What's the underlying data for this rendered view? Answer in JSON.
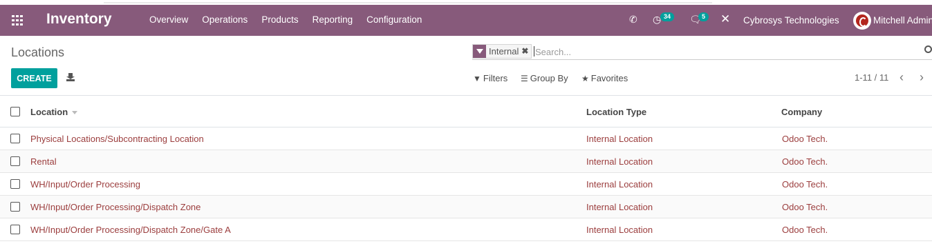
{
  "navbar": {
    "app_name": "Inventory",
    "menu": [
      "Overview",
      "Operations",
      "Products",
      "Reporting",
      "Configuration"
    ],
    "activities_count": "34",
    "messages_count": "5",
    "company": "Cybrosys Technologies",
    "user": "Mitchell Admin",
    "bg_color": "#875a7b"
  },
  "control_panel": {
    "title": "Locations",
    "create_label": "CREATE",
    "facet": "Internal",
    "search_placeholder": "Search...",
    "filters_label": "Filters",
    "groupby_label": "Group By",
    "favorites_label": "Favorites",
    "pager": "1-11 / 11",
    "accent_color": "#00a09d"
  },
  "table": {
    "columns": [
      "Location",
      "Location Type",
      "Company"
    ],
    "rows": [
      {
        "location": "Physical Locations/Subcontracting Location",
        "type": "Internal Location",
        "company": "Odoo Tech."
      },
      {
        "location": "Rental",
        "type": "Internal Location",
        "company": "Odoo Tech."
      },
      {
        "location": "WH/Input/Order Processing",
        "type": "Internal Location",
        "company": "Odoo Tech."
      },
      {
        "location": "WH/Input/Order Processing/Dispatch Zone",
        "type": "Internal Location",
        "company": "Odoo Tech."
      },
      {
        "location": "WH/Input/Order Processing/Dispatch Zone/Gate A",
        "type": "Internal Location",
        "company": "Odoo Tech."
      }
    ]
  }
}
